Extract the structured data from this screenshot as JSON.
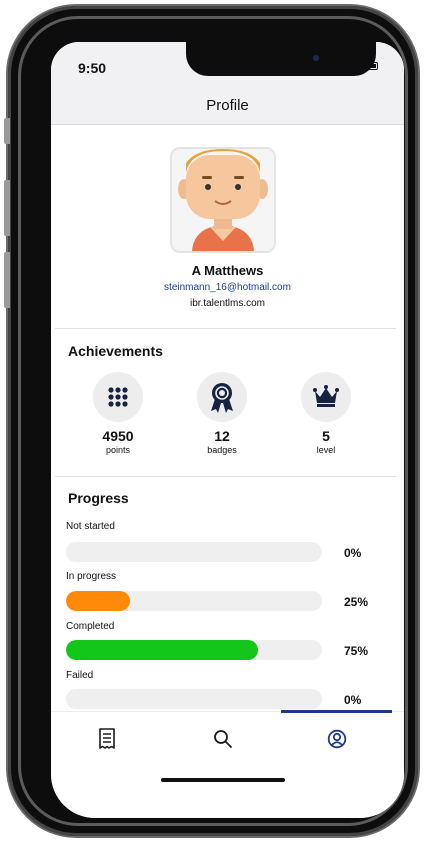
{
  "status": {
    "time": "9:50"
  },
  "header": {
    "title": "Profile"
  },
  "user": {
    "name": "A Matthews",
    "email": "steinmann_16@hotmail.com",
    "domain": "ibr.talentlms.com"
  },
  "achievements": {
    "title": "Achievements",
    "items": [
      {
        "value": "4950",
        "label": "points",
        "icon": "grid-dots-icon"
      },
      {
        "value": "12",
        "label": "badges",
        "icon": "badge-ribbon-icon"
      },
      {
        "value": "5",
        "label": "level",
        "icon": "crown-icon"
      }
    ]
  },
  "progress": {
    "title": "Progress",
    "items": [
      {
        "label": "Not started",
        "percent_text": "0%",
        "fraction": 0.0,
        "color": "#efefef"
      },
      {
        "label": "In progress",
        "percent_text": "25%",
        "fraction": 0.25,
        "color": "#ff8a0a"
      },
      {
        "label": "Completed",
        "percent_text": "75%",
        "fraction": 0.75,
        "color": "#12c61a"
      },
      {
        "label": "Failed",
        "percent_text": "0%",
        "fraction": 0.0,
        "color": "#e02020"
      }
    ]
  },
  "tabs": [
    {
      "name": "courses",
      "icon": "document-list-icon",
      "active": false
    },
    {
      "name": "search",
      "icon": "search-icon",
      "active": false
    },
    {
      "name": "profile",
      "icon": "profile-icon",
      "active": true
    }
  ],
  "colors": {
    "accent": "#1d3a8f",
    "link": "#1a3d9a"
  }
}
